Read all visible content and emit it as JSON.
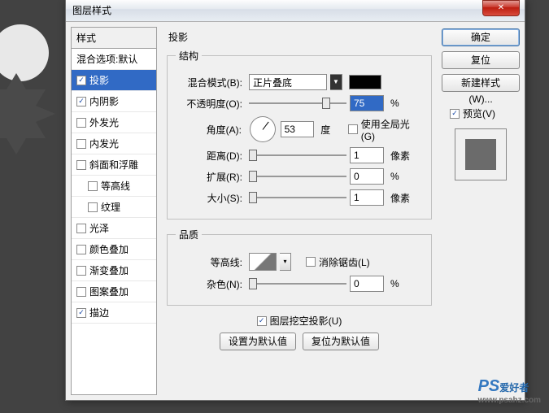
{
  "dialog": {
    "title": "图层样式",
    "close": "✕"
  },
  "styles": {
    "header": "样式",
    "blend_defaults": "混合选项:默认",
    "items": [
      {
        "label": "投影",
        "checked": true,
        "selected": true
      },
      {
        "label": "内阴影",
        "checked": true
      },
      {
        "label": "外发光",
        "checked": false
      },
      {
        "label": "内发光",
        "checked": false
      },
      {
        "label": "斜面和浮雕",
        "checked": false
      },
      {
        "label": "等高线",
        "checked": false,
        "indent": true
      },
      {
        "label": "纹理",
        "checked": false,
        "indent": true
      },
      {
        "label": "光泽",
        "checked": false
      },
      {
        "label": "颜色叠加",
        "checked": false
      },
      {
        "label": "渐变叠加",
        "checked": false
      },
      {
        "label": "图案叠加",
        "checked": false
      },
      {
        "label": "描边",
        "checked": true
      }
    ]
  },
  "main": {
    "title": "投影",
    "structure": {
      "legend": "结构",
      "blend_mode_label": "混合模式(B):",
      "blend_mode_value": "正片叠底",
      "opacity_label": "不透明度(O):",
      "opacity_value": "75",
      "opacity_unit": "%",
      "angle_label": "角度(A):",
      "angle_value": "53",
      "angle_unit": "度",
      "global_light": "使用全局光(G)",
      "distance_label": "距离(D):",
      "distance_value": "1",
      "distance_unit": "像素",
      "spread_label": "扩展(R):",
      "spread_value": "0",
      "spread_unit": "%",
      "size_label": "大小(S):",
      "size_value": "1",
      "size_unit": "像素"
    },
    "quality": {
      "legend": "品质",
      "contour_label": "等高线:",
      "antialias": "消除锯齿(L)",
      "noise_label": "杂色(N):",
      "noise_value": "0",
      "noise_unit": "%"
    },
    "knockout": "图层挖空投影(U)",
    "set_default": "设置为默认值",
    "reset_default": "复位为默认值"
  },
  "side": {
    "ok": "确定",
    "cancel": "复位",
    "new_style": "新建样式(W)...",
    "preview": "预览(V)"
  },
  "watermark": {
    "ps": "PS",
    "txt": "爱好者",
    "url": "www.psahz.com"
  }
}
